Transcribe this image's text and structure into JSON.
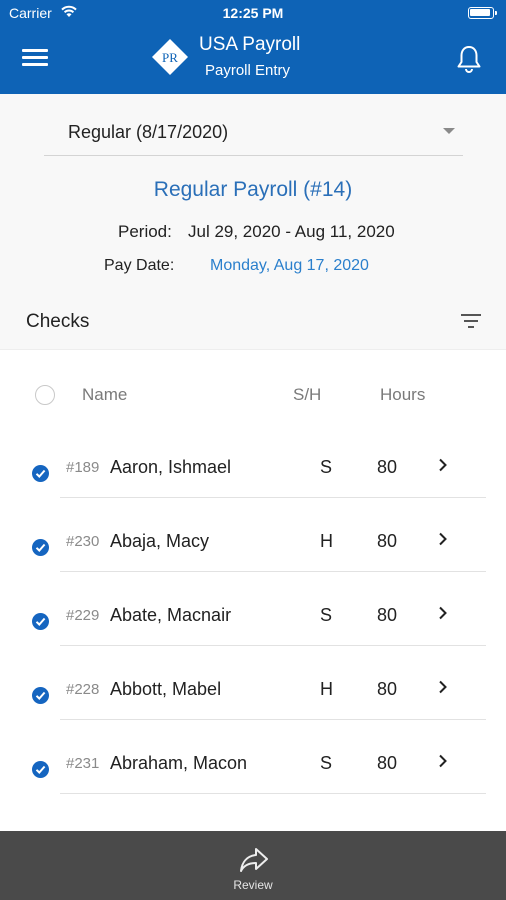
{
  "status_bar": {
    "carrier": "Carrier",
    "time": "12:25 PM"
  },
  "header": {
    "title": "USA Payroll",
    "subtitle": "Payroll Entry",
    "logo_text": "PR"
  },
  "payroll_select": {
    "value": "Regular (8/17/2020)"
  },
  "payroll": {
    "title": "Regular Payroll (#14)",
    "period_label": "Period:",
    "period_value": "Jul 29, 2020 - Aug 11, 2020",
    "pay_date_label": "Pay Date:",
    "pay_date_value": "Monday, Aug 17, 2020"
  },
  "checks": {
    "title": "Checks",
    "columns": {
      "name": "Name",
      "sh": "S/H",
      "hours": "Hours"
    },
    "rows": [
      {
        "number": "#189",
        "name": "Aaron, Ishmael",
        "sh": "S",
        "hours": "80",
        "selected": true
      },
      {
        "number": "#230",
        "name": "Abaja, Macy",
        "sh": "H",
        "hours": "80",
        "selected": true
      },
      {
        "number": "#229",
        "name": "Abate, Macnair",
        "sh": "S",
        "hours": "80",
        "selected": true
      },
      {
        "number": "#228",
        "name": "Abbott, Mabel",
        "sh": "H",
        "hours": "80",
        "selected": true
      },
      {
        "number": "#231",
        "name": "Abraham, Macon",
        "sh": "S",
        "hours": "80",
        "selected": true
      }
    ]
  },
  "bottom_bar": {
    "review_label": "Review",
    "review_icon": "share-forward-icon"
  },
  "colors": {
    "brand": "#0e63b6",
    "link": "#2a7fcc",
    "check": "#1565c0",
    "bottom_bar": "#4a4a4a"
  }
}
